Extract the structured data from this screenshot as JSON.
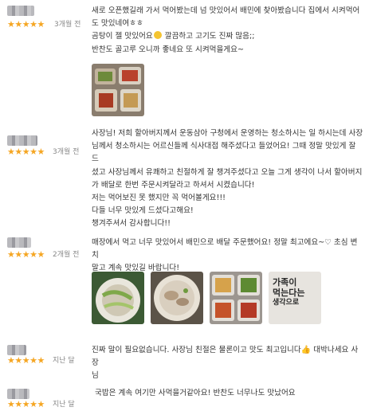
{
  "reviews": [
    {
      "stars": "★★★★★",
      "date": "3개월 전",
      "lines": [
        "새로 오픈했길래 가서 먹어봤는데 넘 맛있어서 배민에 찾아봤습니다 집에서 시켜먹어",
        "도 맛있네여ㅎㅎ",
        "곰탕이 젤 맛있어요",
        "반찬도 골고루 오니까 좋네요 또 시켜먹을게요~"
      ],
      "line3_suffix": " 깔끔하고 고기도 진짜 많음;;",
      "photos": [
        "side-dishes-photo"
      ]
    },
    {
      "stars": "★★★★★",
      "date": "3개월 전",
      "lines": [
        "사장님! 저희 할아버지께서 운동삼아 구청에서 운영하는 청소하시는 일 하시는데 사장",
        "님께서 청소하시는 어르신들께 식사대접 해주셨다고 들었어요! 그때 정말 맛있게 잘 드",
        "셨고 사장님께서 유쾌하고 친절하게 잘 챙겨주셨다고 오늘 그게 생각이 나서 할아버지",
        "가 배달로 한번 주문시켜달라고 하셔서 시켰습니다!",
        "저는 먹어보진 못 했지만 꼭 먹어볼게요!!!",
        "다들 너무 맛있게 드셨다고해요!",
        "챙겨주셔서 감사합니다!!"
      ]
    },
    {
      "stars": "★★★★★",
      "date": "2개월 전",
      "lines": [
        "매장에서 먹고 너무 맛있어서 배민으로 배달 주문했어요! 정말 최고에요~♡ 초심 변치",
        "말고 계속 맛있길 바랍니다!"
      ],
      "photos": [
        "noodle-soup-photo",
        "gomtang-bowl-photo",
        "banchan-photo",
        "package-photo"
      ],
      "package_text": [
        "가족이",
        "먹는다는",
        "생각으로"
      ]
    },
    {
      "stars": "★★★★★",
      "date": "지난 달",
      "lines": [
        "진짜 말이 필요없습니다. 사장님 친절은 물론이고 맛도 최고입니다",
        "님"
      ],
      "line1_suffix": " 대박나세요 사장"
    },
    {
      "stars": "★★★★★",
      "date": "지난 달",
      "lines": [
        "국밥은 계속 여기만 사먹을거같아요! 반찬도 너무나도 맛났어요"
      ]
    }
  ]
}
